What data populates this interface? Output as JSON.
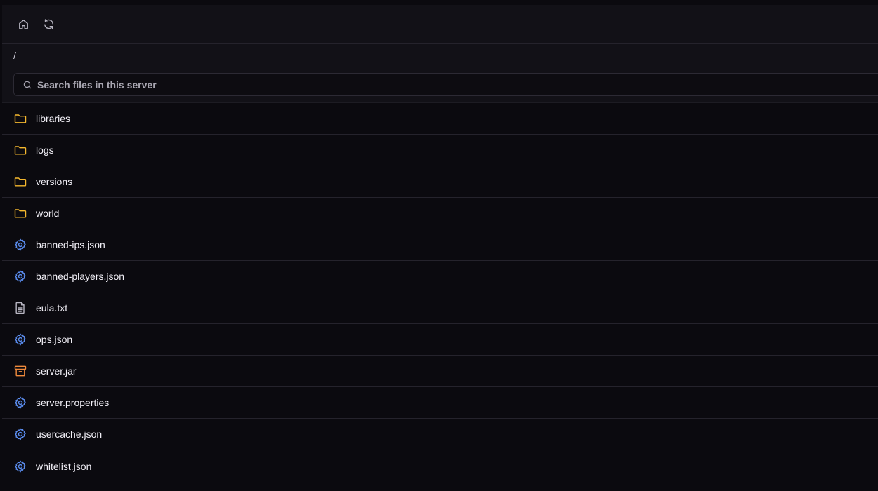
{
  "toolbar": {
    "home_icon": "home-icon",
    "refresh_icon": "refresh-icon"
  },
  "breadcrumb": {
    "path": "/"
  },
  "search": {
    "placeholder": "Search files in this server",
    "value": ""
  },
  "colors": {
    "folder": "#f5b82e",
    "config": "#5b8def",
    "text": "#b8b6c2",
    "archive": "#f08a3c"
  },
  "files": [
    {
      "name": "libraries",
      "type": "folder",
      "icon": "folder-icon"
    },
    {
      "name": "logs",
      "type": "folder",
      "icon": "folder-icon"
    },
    {
      "name": "versions",
      "type": "folder",
      "icon": "folder-icon"
    },
    {
      "name": "world",
      "type": "folder",
      "icon": "folder-icon"
    },
    {
      "name": "banned-ips.json",
      "type": "config",
      "icon": "gear-icon"
    },
    {
      "name": "banned-players.json",
      "type": "config",
      "icon": "gear-icon"
    },
    {
      "name": "eula.txt",
      "type": "text",
      "icon": "file-text-icon"
    },
    {
      "name": "ops.json",
      "type": "config",
      "icon": "gear-icon"
    },
    {
      "name": "server.jar",
      "type": "archive",
      "icon": "archive-icon"
    },
    {
      "name": "server.properties",
      "type": "config",
      "icon": "gear-icon"
    },
    {
      "name": "usercache.json",
      "type": "config",
      "icon": "gear-icon"
    },
    {
      "name": "whitelist.json",
      "type": "config",
      "icon": "gear-icon"
    }
  ]
}
